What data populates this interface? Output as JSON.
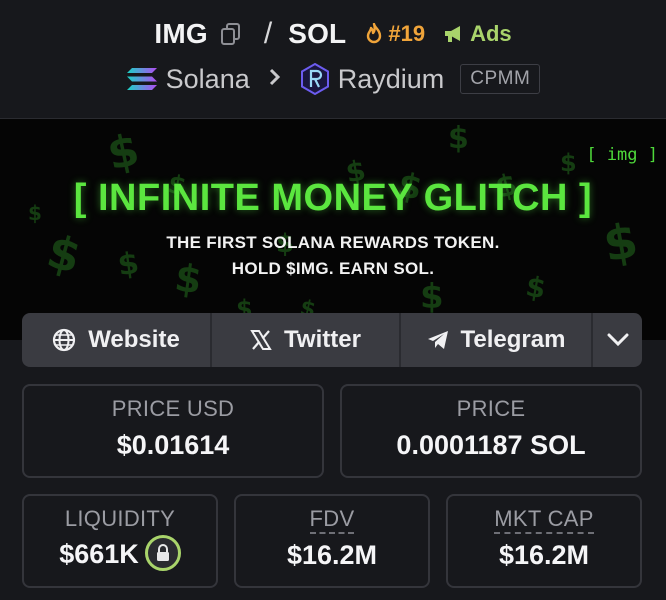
{
  "header": {
    "base_symbol": "IMG",
    "separator": "/",
    "quote_symbol": "SOL",
    "rank": "#19",
    "ads_label": "Ads",
    "chain_name": "Solana",
    "dex_name": "Raydium",
    "pool_type": "CPMM"
  },
  "banner": {
    "tag": "[ img ]",
    "title": "[ INFINITE MONEY GLITCH ]",
    "line1": "THE FIRST SOLANA REWARDS TOKEN.",
    "line2": "HOLD $IMG. EARN SOL."
  },
  "links": {
    "website": "Website",
    "twitter": "Twitter",
    "telegram": "Telegram"
  },
  "stats": {
    "price_usd_label": "PRICE USD",
    "price_usd": "$0.01614",
    "price_label": "PRICE",
    "price_sol": "0.0001187 SOL",
    "liquidity_label": "LIQUIDITY",
    "liquidity": "$661K",
    "fdv_label": "FDV",
    "fdv": "$16.2M",
    "mkt_cap_label": "MKT CAP",
    "mkt_cap": "$16.2M"
  },
  "colors": {
    "background": "#17181c",
    "rank": "#f0a43a",
    "ads": "#a9d46b",
    "banner_green": "#5be63f"
  },
  "icons": [
    "copy-icon",
    "flame-icon",
    "megaphone-icon",
    "solana-icon",
    "raydium-icon",
    "chevron-right-icon",
    "globe-icon",
    "x-icon",
    "telegram-icon",
    "chevron-down-icon",
    "lock-icon"
  ]
}
